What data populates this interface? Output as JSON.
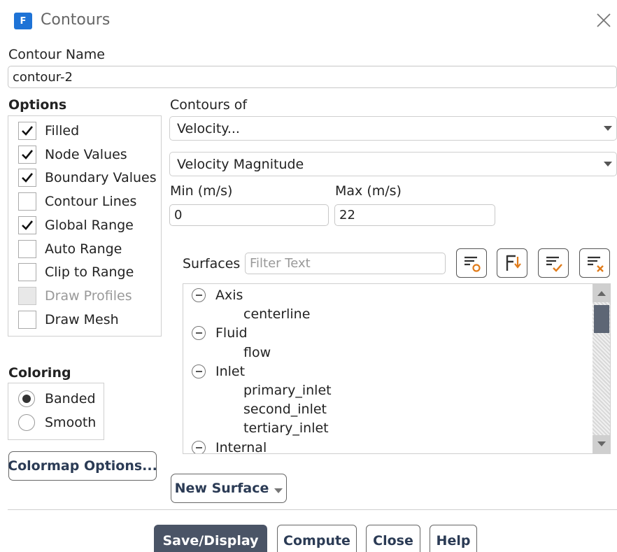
{
  "window": {
    "title": "Contours",
    "icon_letter": "F"
  },
  "contour_name": {
    "label": "Contour Name",
    "value": "contour-2"
  },
  "options": {
    "label": "Options",
    "items": [
      {
        "label": "Filled",
        "checked": true,
        "disabled": false
      },
      {
        "label": "Node Values",
        "checked": true,
        "disabled": false
      },
      {
        "label": "Boundary Values",
        "checked": true,
        "disabled": false
      },
      {
        "label": "Contour Lines",
        "checked": false,
        "disabled": false
      },
      {
        "label": "Global Range",
        "checked": true,
        "disabled": false
      },
      {
        "label": "Auto Range",
        "checked": false,
        "disabled": false
      },
      {
        "label": "Clip to Range",
        "checked": false,
        "disabled": false
      },
      {
        "label": "Draw Profiles",
        "checked": false,
        "disabled": true
      },
      {
        "label": "Draw Mesh",
        "checked": false,
        "disabled": false
      }
    ]
  },
  "coloring": {
    "label": "Coloring",
    "options": [
      {
        "label": "Banded",
        "selected": true
      },
      {
        "label": "Smooth",
        "selected": false
      }
    ]
  },
  "colormap_button": "Colormap Options...",
  "contours_of": {
    "label": "Contours of",
    "category": "Velocity...",
    "field": "Velocity Magnitude"
  },
  "range": {
    "min_label": "Min (m/s)",
    "min_value": "0",
    "max_label": "Max (m/s)",
    "max_value": "22"
  },
  "surfaces": {
    "label": "Surfaces",
    "filter_placeholder": "Filter Text",
    "tree": [
      {
        "group": "Axis",
        "children": [
          "centerline"
        ]
      },
      {
        "group": "Fluid",
        "children": [
          "flow"
        ]
      },
      {
        "group": "Inlet",
        "children": [
          "primary_inlet",
          "second_inlet",
          "tertiary_inlet"
        ]
      },
      {
        "group": "Internal",
        "children": []
      }
    ]
  },
  "new_surface_button": "New Surface",
  "footer": {
    "save_display": "Save/Display",
    "compute": "Compute",
    "close": "Close",
    "help": "Help"
  },
  "colors": {
    "accent": "#1e73d6",
    "primary_button": "#4a5466",
    "disabled_text": "#999999"
  }
}
